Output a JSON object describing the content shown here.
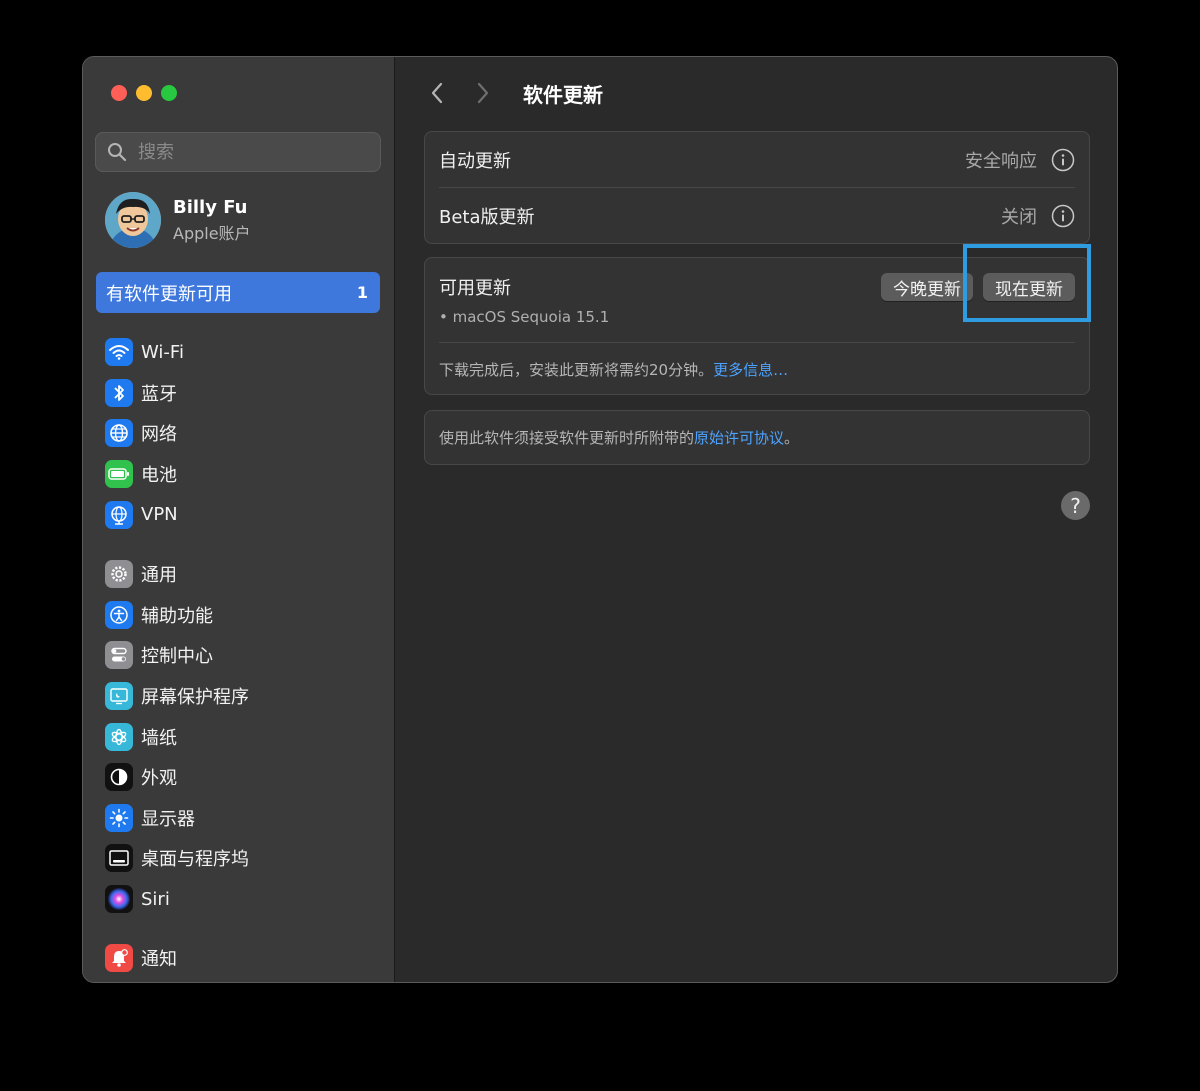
{
  "sidebar": {
    "search_placeholder": "搜索",
    "account": {
      "name": "Billy Fu",
      "subtitle": "Apple账户"
    },
    "update_item": {
      "label": "有软件更新可用",
      "badge": "1"
    },
    "groups": [
      [
        {
          "label": "Wi-Fi",
          "icon": "wifi-icon",
          "color": "#1f7af0"
        },
        {
          "label": "蓝牙",
          "icon": "bluetooth-icon",
          "color": "#1f7af0"
        },
        {
          "label": "网络",
          "icon": "globe-icon",
          "color": "#1f7af0"
        },
        {
          "label": "电池",
          "icon": "battery-icon",
          "color": "#31c24d"
        },
        {
          "label": "VPN",
          "icon": "vpn-icon",
          "color": "#1f7af0"
        }
      ],
      [
        {
          "label": "通用",
          "icon": "gear-icon",
          "color": "#8e8e93"
        },
        {
          "label": "辅助功能",
          "icon": "accessibility-icon",
          "color": "#1f7af0"
        },
        {
          "label": "控制中心",
          "icon": "control-center-icon",
          "color": "#8e8e93"
        },
        {
          "label": "屏幕保护程序",
          "icon": "screensaver-icon",
          "color": "#38b8d8"
        },
        {
          "label": "墙纸",
          "icon": "wallpaper-icon",
          "color": "#38b8d8"
        },
        {
          "label": "外观",
          "icon": "appearance-icon",
          "color": "#111111"
        },
        {
          "label": "显示器",
          "icon": "display-icon",
          "color": "#1f7af0"
        },
        {
          "label": "桌面与程序坞",
          "icon": "desktop-dock-icon",
          "color": "#111111"
        },
        {
          "label": "Siri",
          "icon": "siri-icon",
          "color": "#111111"
        }
      ],
      [
        {
          "label": "通知",
          "icon": "notification-icon",
          "color": "#f04a45"
        }
      ]
    ]
  },
  "main": {
    "title": "软件更新",
    "auto_update": {
      "label": "自动更新",
      "value": "安全响应"
    },
    "beta_update": {
      "label": "Beta版更新",
      "value": "关闭"
    },
    "available": {
      "title": "可用更新",
      "item": "• macOS Sequoia 15.1",
      "tonight_button": "今晚更新",
      "now_button": "现在更新",
      "note": "下载完成后，安装此更新将需约20分钟。",
      "more_info": "更多信息…"
    },
    "license": {
      "text": "使用此软件须接受软件更新时所附带的",
      "link": "原始许可协议",
      "suffix": "。"
    },
    "help": "?"
  }
}
